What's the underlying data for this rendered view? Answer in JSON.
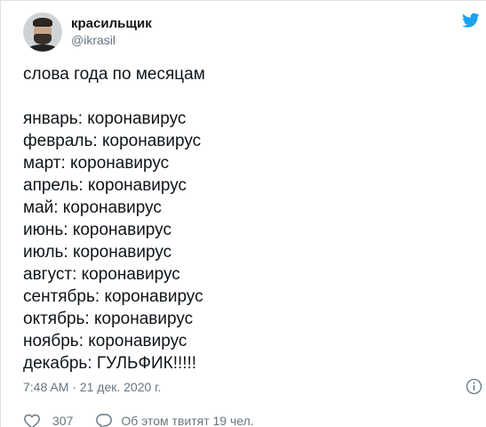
{
  "author": {
    "display_name": "красильщик",
    "handle": "@ikrasil"
  },
  "tweet": {
    "lines": [
      "слова года по месяцам",
      "",
      "январь: коронавирус",
      "февраль: коронавирус",
      "март: коронавирус",
      "апрель: коронавирус",
      "май: коронавирус",
      "июнь: коронавирус",
      "июль: коронавирус",
      "август: коронавирус",
      "сентябрь: коронавирус",
      "октябрь: коронавирус",
      "ноябрь: коронавирус",
      "декабрь: ГУЛЬФИК!!!!!"
    ],
    "timestamp": "7:48 AM · 21 дек. 2020 г."
  },
  "actions": {
    "like_count": "307",
    "reply_label": "Об этом твитят 19 чел."
  },
  "icons": {
    "brand": "twitter-bird-icon",
    "info": "info-icon",
    "like": "heart-icon",
    "reply": "comment-bubble-icon"
  },
  "colors": {
    "brand": "#1da1f2",
    "text": "#0f1419",
    "secondary": "#66757f"
  }
}
